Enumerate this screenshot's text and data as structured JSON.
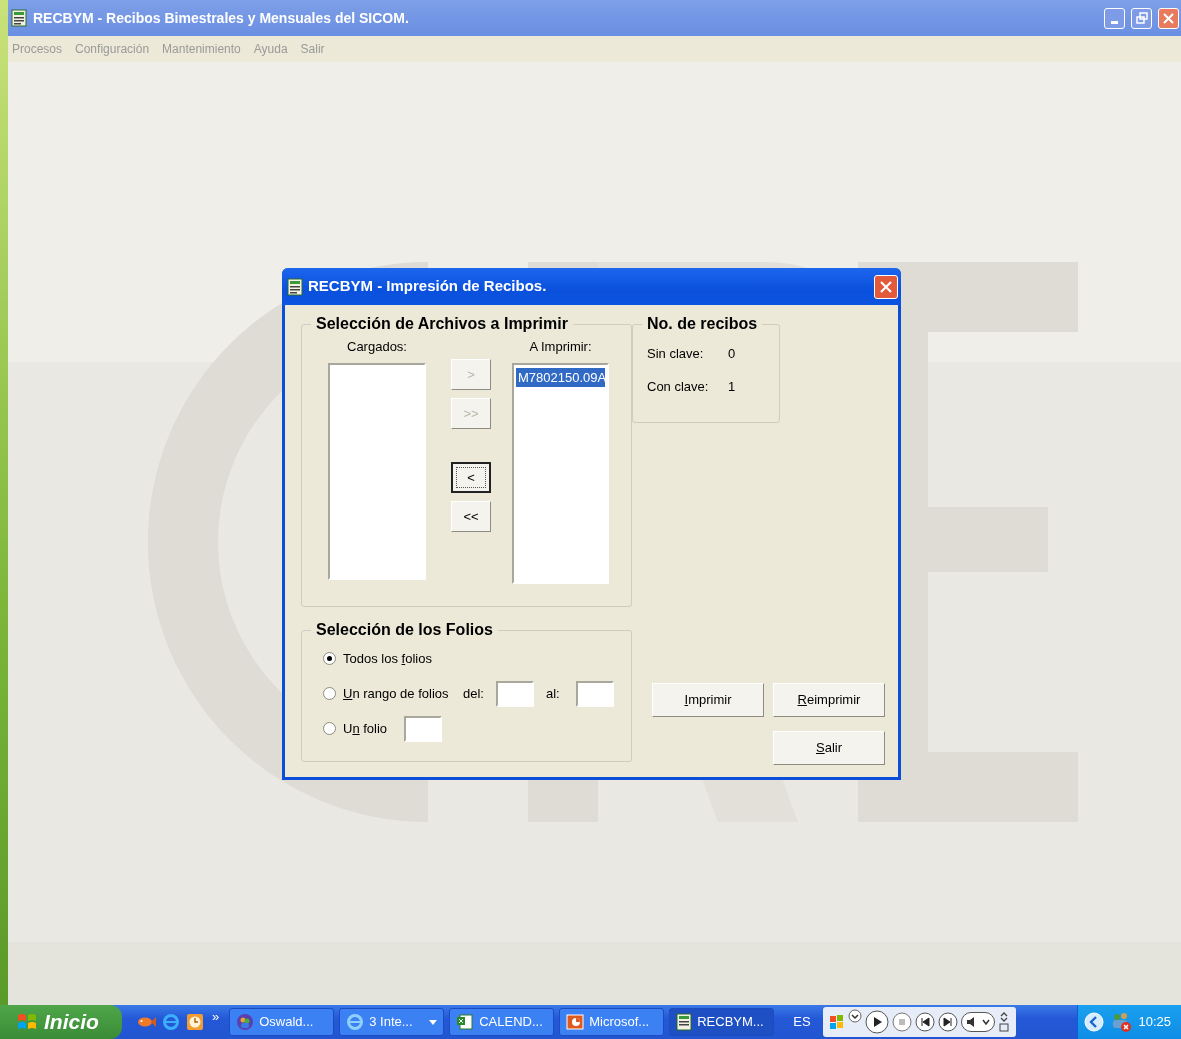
{
  "window": {
    "title": "RECBYM - Recibos Bimestrales y Mensuales del SICOM."
  },
  "menu": [
    {
      "label": "Procesos",
      "disabled": true
    },
    {
      "label": "Configuración",
      "disabled": true
    },
    {
      "label": "Mantenimiento",
      "disabled": true
    },
    {
      "label": "Ayuda",
      "disabled": true
    },
    {
      "label": "Salir",
      "disabled": true
    }
  ],
  "dialog": {
    "title": "RECBYM - Impresión de Recibos.",
    "files_group": {
      "title": "Selección de Archivos a Imprimir",
      "loaded": {
        "label": "Cargados:"
      },
      "move_buttons": [
        {
          "label": ">",
          "disabled": true,
          "focused": false
        },
        {
          "label": ">>",
          "disabled": true,
          "focused": false
        },
        {
          "label": "<",
          "disabled": false,
          "focused": true
        },
        {
          "label": "<<",
          "disabled": false,
          "focused": false
        }
      ],
      "to_print": {
        "label": "A Imprimir:",
        "items": [
          {
            "text": "M7802150.09A",
            "selected": true
          }
        ]
      }
    },
    "count_group": {
      "title": "No. de recibos",
      "rows": [
        {
          "label": "Sin clave:",
          "value": "0"
        },
        {
          "label": "Con clave:",
          "value": "1"
        }
      ]
    },
    "folios_group": {
      "title": "Selección de los Folios",
      "options": [
        {
          "kind": "all",
          "label_parts": [
            {
              "text": "Todos los ",
              "underlined": false
            },
            {
              "text": "f",
              "underlined": true
            },
            {
              "text": "olios",
              "underlined": false
            }
          ],
          "selected": true
        },
        {
          "kind": "range",
          "label_parts": [
            {
              "text": "U",
              "underlined": true
            },
            {
              "text": "n rango de folios",
              "underlined": false
            }
          ],
          "selected": false,
          "from_label": "del:",
          "to_label": "al:"
        },
        {
          "kind": "single",
          "label_parts": [
            {
              "text": "U",
              "underlined": false
            },
            {
              "text": "n",
              "underlined": true
            },
            {
              "text": " folio",
              "underlined": false
            }
          ],
          "selected": false
        }
      ]
    },
    "buttons": [
      {
        "label_parts": [
          {
            "text": "I",
            "underlined": true
          },
          {
            "text": "mprimir",
            "underlined": false
          }
        ]
      },
      {
        "label_parts": [
          {
            "text": "R",
            "underlined": true
          },
          {
            "text": "eimprimir",
            "underlined": false
          }
        ]
      },
      {
        "label_parts": [
          {
            "text": "S",
            "underlined": true
          },
          {
            "text": "alir",
            "underlined": false
          }
        ]
      }
    ]
  },
  "taskbar": {
    "start": "Inicio",
    "chevron": "»",
    "tasks": [
      {
        "label": "Oswald...",
        "kind": "messenger",
        "grouped": false,
        "active": false
      },
      {
        "label": "3 Inte...",
        "kind": "browser",
        "grouped": true,
        "active": false
      },
      {
        "label": "CALEND...",
        "kind": "spreadsheet",
        "grouped": false,
        "active": false
      },
      {
        "label": "Microsof...",
        "kind": "presentation",
        "grouped": false,
        "active": false
      },
      {
        "label": "RECBYM...",
        "kind": "app",
        "grouped": false,
        "active": true
      }
    ],
    "language": "ES",
    "clock": "10:25"
  }
}
